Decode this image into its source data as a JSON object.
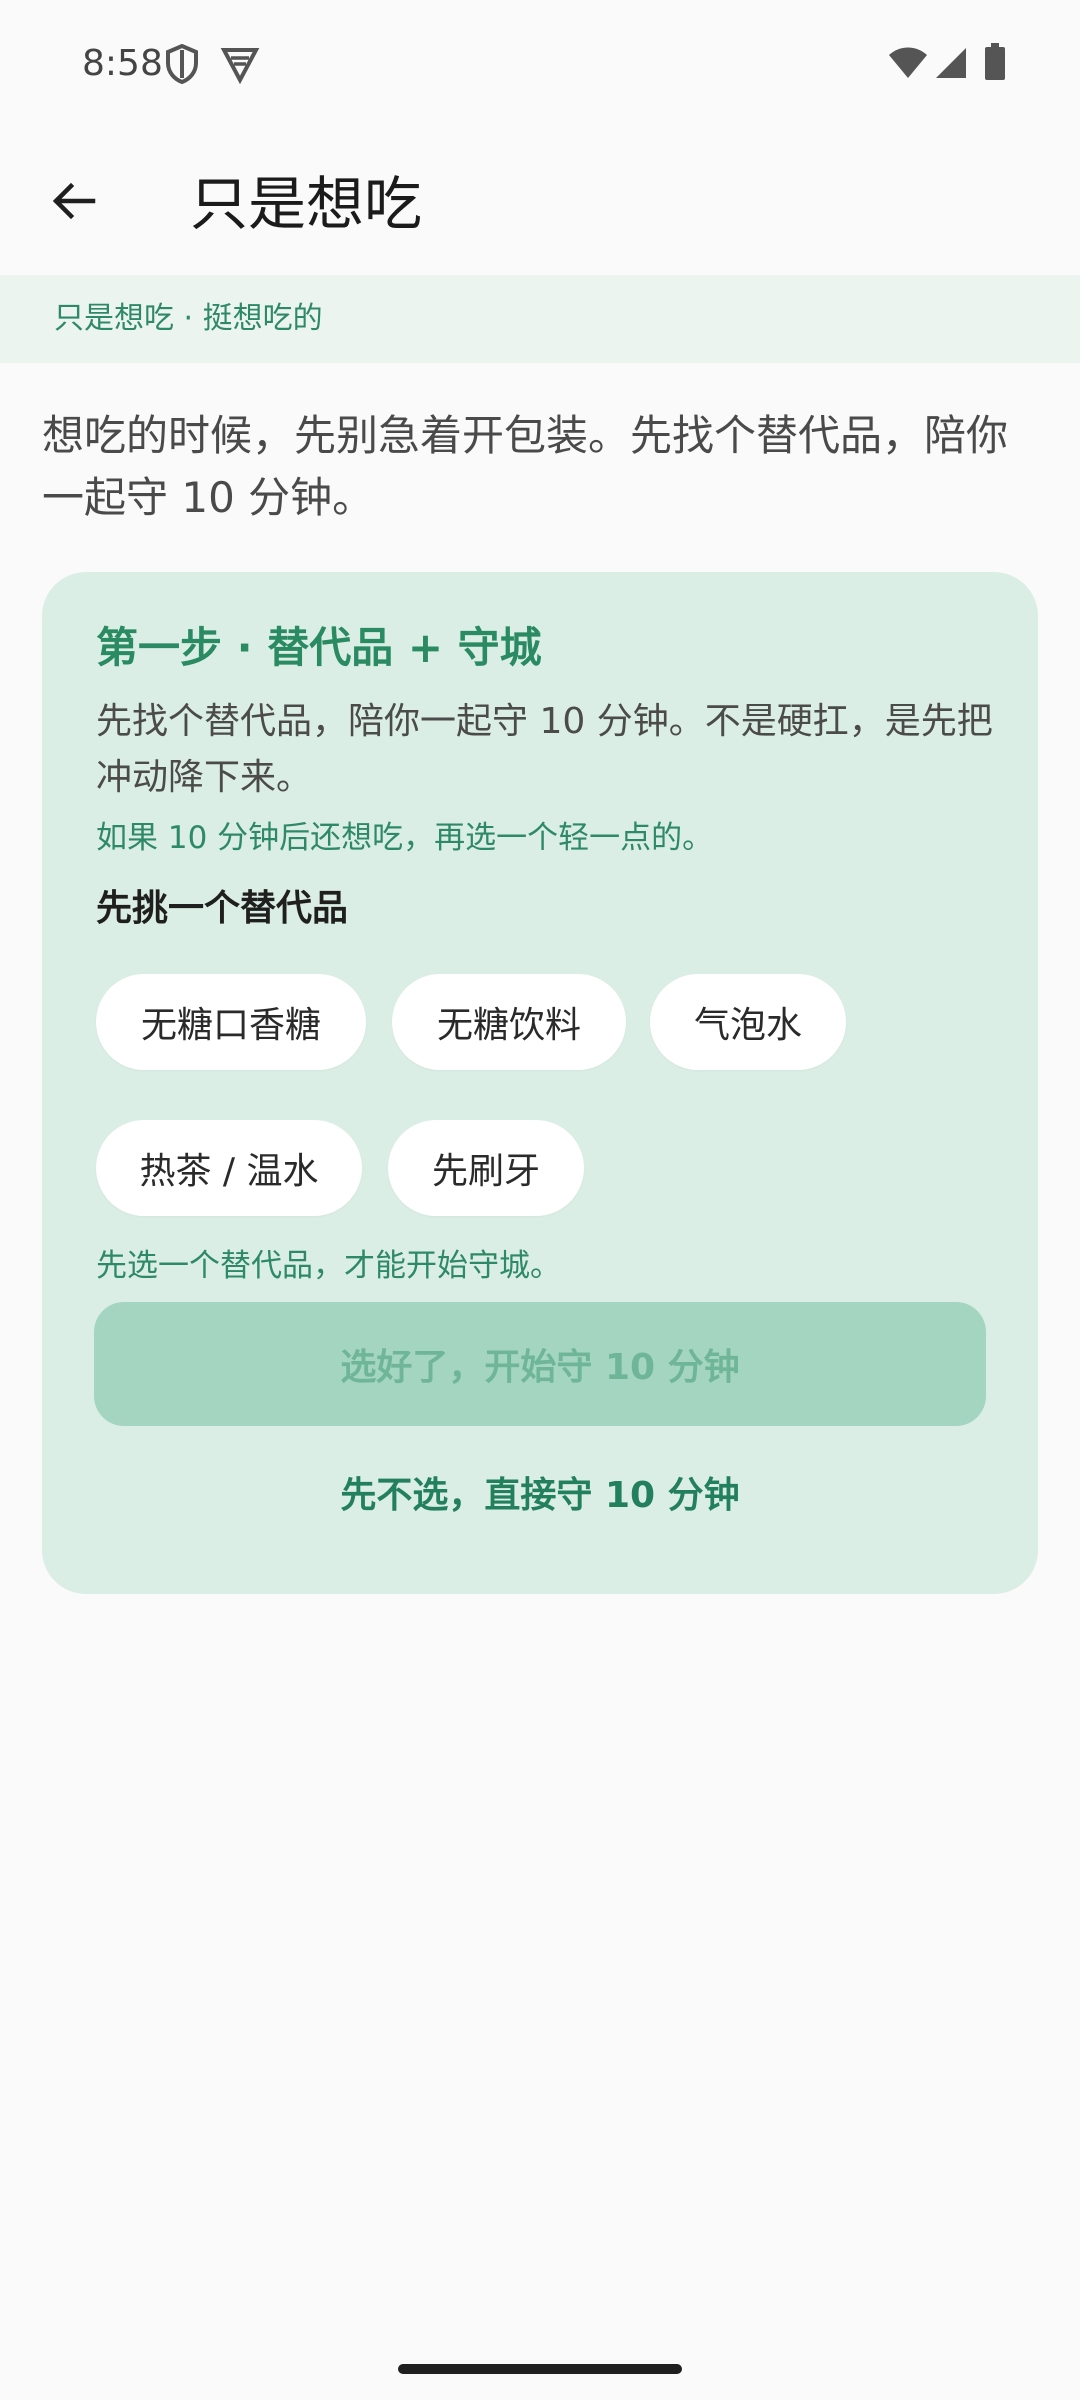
{
  "status_bar": {
    "time": "8:58",
    "icons": [
      "shield-icon",
      "vpn-shield-icon",
      "wifi-icon",
      "signal-icon",
      "battery-icon"
    ]
  },
  "app_bar": {
    "back_icon": "arrow-left-icon",
    "title": "只是想吃"
  },
  "breadcrumb": "只是想吃 · 挺想吃的",
  "intro": "想吃的时候，先别急着开包装。先找个替代品，陪你一起守 10 分钟。",
  "card": {
    "title": "第一步 · 替代品 + 守城",
    "description": "先找个替代品，陪你一起守 10 分钟。不是硬扛，是先把冲动降下来。",
    "hint": "如果 10 分钟后还想吃，再选一个轻一点的。",
    "pick_label": "先挑一个替代品",
    "options": [
      "无糖口香糖",
      "无糖饮料",
      "气泡水",
      "热茶 / 温水",
      "先刷牙"
    ],
    "warning": "先选一个替代品，才能开始守城。",
    "primary_button": "选好了，开始守 10 分钟",
    "primary_enabled": false,
    "secondary_button": "先不选，直接守 10 分钟"
  },
  "colors": {
    "accent": "#2a8a62",
    "card_bg": "#dbeee5",
    "strip_bg": "#ecf4ef",
    "disabled_button": "#a3d5c0"
  }
}
